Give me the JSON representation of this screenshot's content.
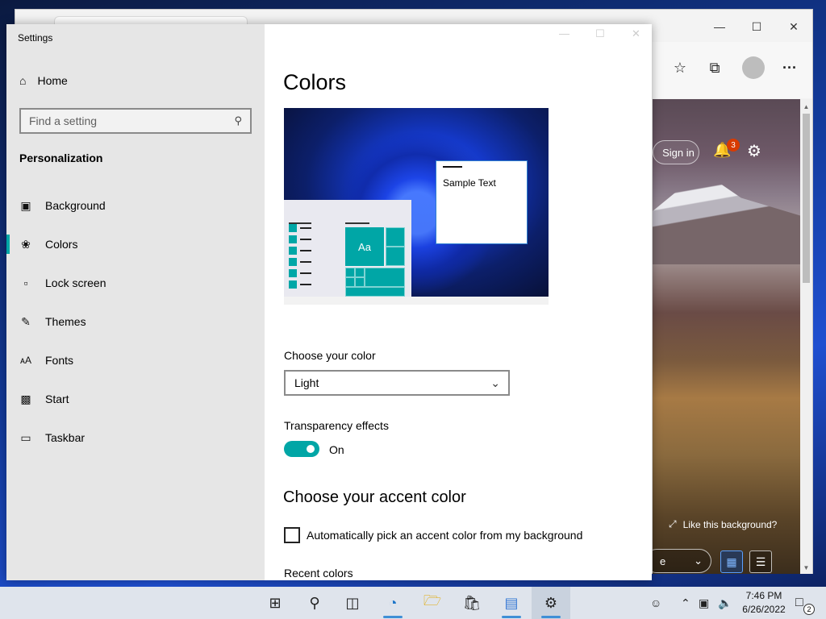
{
  "browser": {
    "toolbar_icons": [
      "favorites-icon",
      "collections-icon",
      "profile-icon",
      "more-icon"
    ],
    "more_label": "···",
    "content": {
      "signin_label": "Sign in",
      "notification_count": "3",
      "like_background_label": "Like this background?",
      "dropdown_label": "e"
    }
  },
  "settings": {
    "window_title": "Settings",
    "home_label": "Home",
    "search": {
      "placeholder": "Find a setting"
    },
    "section": "Personalization",
    "nav_items": [
      {
        "label": "Background",
        "icon": "picture-icon"
      },
      {
        "label": "Colors",
        "icon": "palette-icon",
        "active": true
      },
      {
        "label": "Lock screen",
        "icon": "lock-screen-icon"
      },
      {
        "label": "Themes",
        "icon": "themes-icon"
      },
      {
        "label": "Fonts",
        "icon": "fonts-icon"
      },
      {
        "label": "Start",
        "icon": "start-icon"
      },
      {
        "label": "Taskbar",
        "icon": "taskbar-icon"
      }
    ],
    "main": {
      "title": "Colors",
      "preview": {
        "sample_text": "Sample Text",
        "tile_label": "Aa"
      },
      "choose_color": {
        "label": "Choose your color",
        "value": "Light"
      },
      "transparency": {
        "label": "Transparency effects",
        "state": "On",
        "enabled": true
      },
      "accent_heading": "Choose your accent color",
      "auto_accent": {
        "label": "Automatically pick an accent color from my background",
        "checked": false
      },
      "recent_colors_label": "Recent colors"
    },
    "accent_color": "#00a6a6"
  },
  "taskbar": {
    "apps": [
      "start-icon",
      "search-icon",
      "task-view-icon",
      "edge-icon",
      "file-explorer-icon",
      "store-icon",
      "control-panel-icon",
      "settings-icon"
    ],
    "clock": {
      "time": "7:46 PM",
      "date": "6/26/2022"
    },
    "notification_count": "2"
  }
}
